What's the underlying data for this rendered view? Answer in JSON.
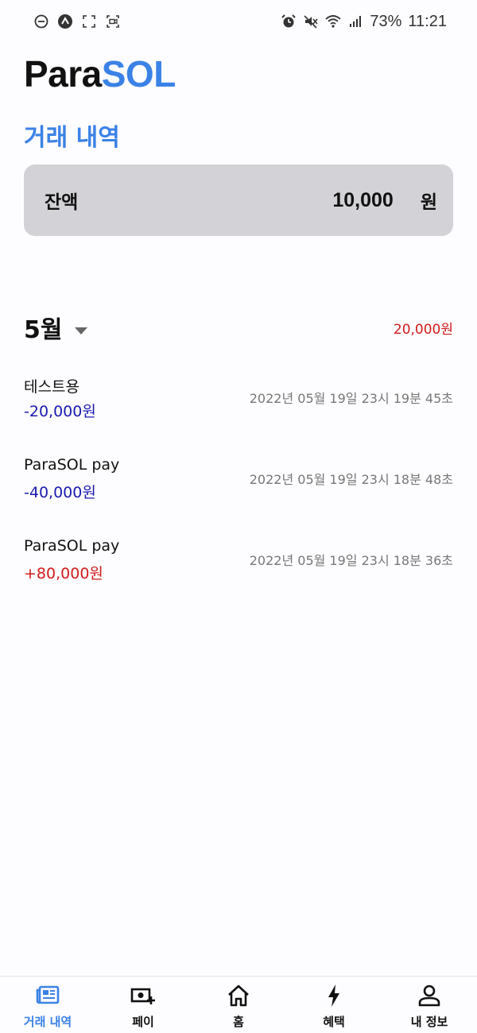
{
  "status_bar": {
    "battery": "73%",
    "time": "11:21"
  },
  "header": {
    "app_title_part1": "Para",
    "app_title_part2": "SOL",
    "page_title": "거래 내역",
    "accent_color": "#3b82e6"
  },
  "balance": {
    "label": "잔액",
    "amount": "10,000",
    "unit": "원"
  },
  "month": {
    "label": "5월",
    "total": "20,000원"
  },
  "transactions": [
    {
      "name": "테스트용",
      "amount": "-20,000원",
      "date": "2022년 05월 19일 23시 19분 45초"
    },
    {
      "name": "ParaSOL pay",
      "amount": "-40,000원",
      "date": "2022년 05월 19일 23시 18분 48초"
    },
    {
      "name": "ParaSOL pay",
      "amount": "+80,000원",
      "date": "2022년 05월 19일 23시 18분 36초"
    }
  ],
  "nav": [
    {
      "label": "거래 내역",
      "icon": "newspaper-icon"
    },
    {
      "label": "페이",
      "icon": "money-add-icon"
    },
    {
      "label": "홈",
      "icon": "home-icon"
    },
    {
      "label": "혜택",
      "icon": "bolt-icon"
    },
    {
      "label": "내 정보",
      "icon": "person-icon"
    }
  ]
}
